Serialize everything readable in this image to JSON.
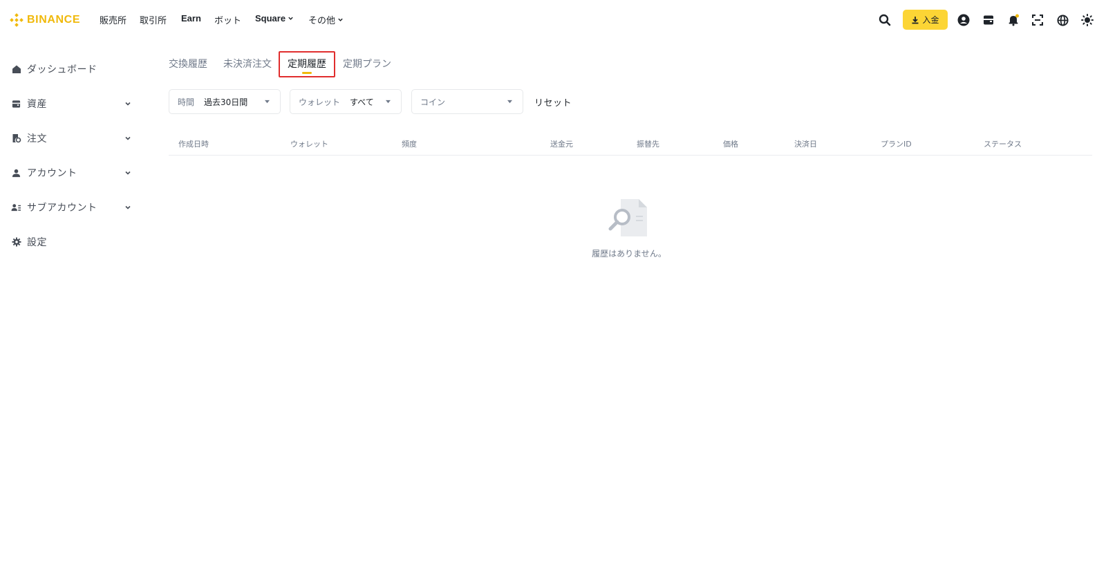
{
  "brand": {
    "name": "BINANCE",
    "color": "#f0b90b"
  },
  "nav": {
    "items": [
      {
        "label": "販売所"
      },
      {
        "label": "取引所"
      },
      {
        "label": "Earn"
      },
      {
        "label": "ボット"
      },
      {
        "label": "Square",
        "dropdown": true
      },
      {
        "label": "その他",
        "dropdown": true
      }
    ],
    "deposit_label": "入金",
    "icons": [
      "search-icon",
      "download-icon",
      "profile-icon",
      "wallet-icon",
      "bell-icon",
      "qr-scan-icon",
      "globe-icon",
      "theme-toggle-icon"
    ]
  },
  "sidebar": {
    "items": [
      {
        "label": "ダッシュボード",
        "icon": "home-icon",
        "expandable": false
      },
      {
        "label": "資産",
        "icon": "wallet-icon",
        "expandable": true
      },
      {
        "label": "注文",
        "icon": "orders-icon",
        "expandable": true
      },
      {
        "label": "アカウント",
        "icon": "user-icon",
        "expandable": true
      },
      {
        "label": "サブアカウント",
        "icon": "subaccount-icon",
        "expandable": true
      },
      {
        "label": "設定",
        "icon": "gear-icon",
        "expandable": false
      }
    ]
  },
  "tabs": {
    "items": [
      {
        "label": "交換履歴"
      },
      {
        "label": "未決済注文"
      },
      {
        "label": "定期履歴",
        "active": true
      },
      {
        "label": "定期プラン"
      }
    ]
  },
  "filters": {
    "time": {
      "label": "時間",
      "value": "過去30日間"
    },
    "wallet": {
      "label": "ウォレット",
      "value": "すべて"
    },
    "coin": {
      "placeholder": "コイン"
    },
    "reset_label": "リセット"
  },
  "table": {
    "columns": [
      "作成日時",
      "ウォレット",
      "頻度",
      "送金元",
      "振替先",
      "価格",
      "決済日",
      "プランID",
      "ステータス"
    ],
    "rows": []
  },
  "empty_state": {
    "message": "履歴はありません。",
    "icon": "empty-search-icon"
  },
  "colors": {
    "accent": "#fcd535",
    "highlight_border": "#e02d2d",
    "muted_text": "#707a8a"
  }
}
